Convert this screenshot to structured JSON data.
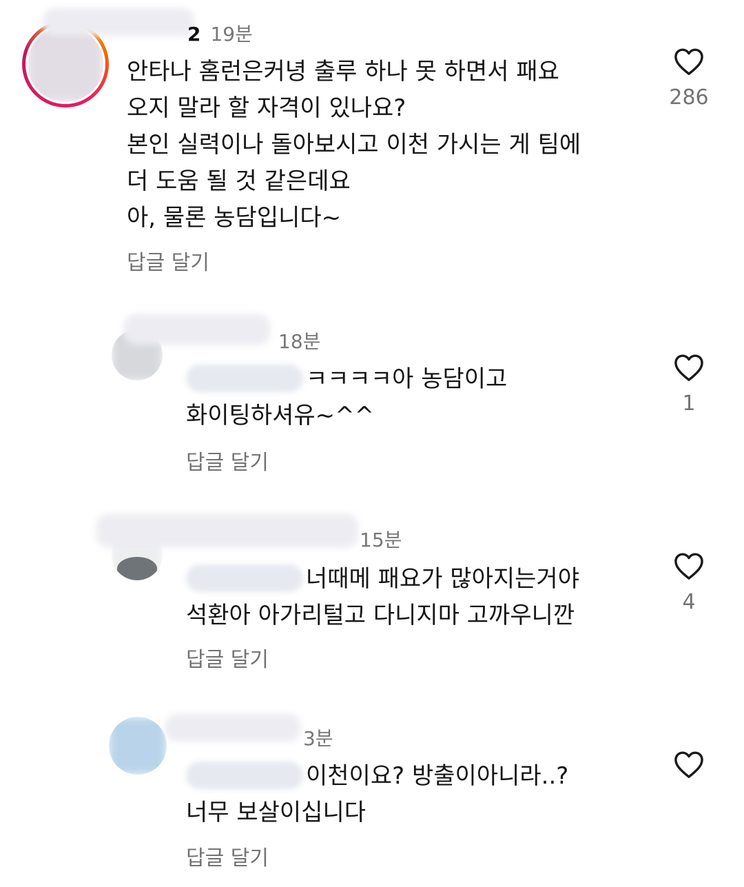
{
  "comments": [
    {
      "username_tail": "2",
      "time": "19분",
      "lines": [
        "안타나 홈런은커녕 출루 하나 못 하면서 패요",
        "오지 말라 할 자격이 있나요?",
        "본인 실력이나 돌아보시고 이천 가시는 게 팀에",
        "더 도움 될 것 같은데요",
        "아, 물론 농담입니다~"
      ],
      "reply_label": "답글 달기",
      "likes": "286"
    },
    {
      "time": "18분",
      "lines": [
        "ㅋㅋㅋㅋ아 농담이고",
        "화이팅하셔유~^^"
      ],
      "reply_label": "답글 달기",
      "likes": "1"
    },
    {
      "time": "15분",
      "lines": [
        "너때메 패요가 많아지는거야",
        "석환아 아가리털고 다니지마 고까우니깐"
      ],
      "reply_label": "답글 달기",
      "likes": "4"
    },
    {
      "time": "3분",
      "lines": [
        "이천이요? 방출이아니라..?",
        "너무 보살이십니다"
      ],
      "reply_label": "답글 달기",
      "likes": ""
    }
  ],
  "icons": {
    "like": "heart-outline-icon"
  },
  "colors": {
    "muted": "#737373",
    "mention": "#3b5bdb",
    "story_ring": "#e91e63"
  }
}
